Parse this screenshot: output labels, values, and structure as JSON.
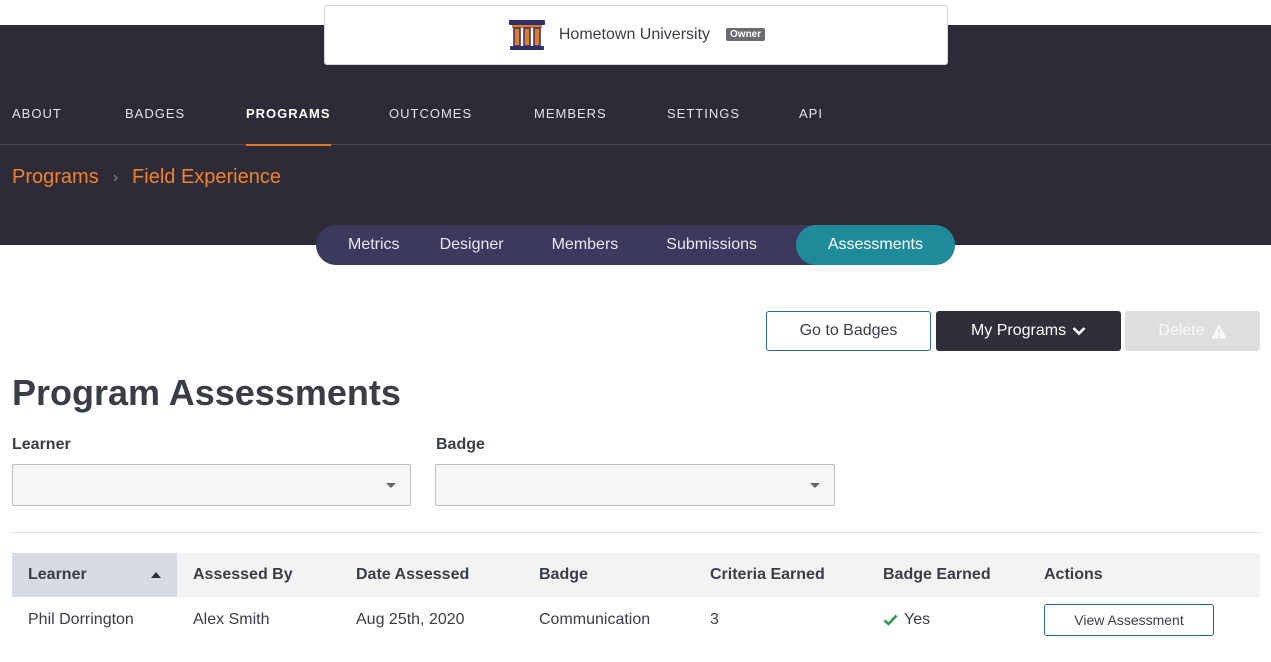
{
  "org": {
    "name": "Hometown University",
    "role_badge": "Owner",
    "logo_icon": "columns-building-icon"
  },
  "nav": {
    "items": [
      "ABOUT",
      "BADGES",
      "PROGRAMS",
      "OUTCOMES",
      "MEMBERS",
      "SETTINGS",
      "API"
    ],
    "active": "PROGRAMS"
  },
  "breadcrumb": {
    "root": "Programs",
    "current": "Field Experience",
    "separator_icon": "chevron-right-icon"
  },
  "subtabs": {
    "items": [
      "Metrics",
      "Designer",
      "Members",
      "Submissions",
      "Assessments"
    ],
    "active": "Assessments"
  },
  "actions": {
    "go_to_badges": "Go to Badges",
    "my_programs": "My Programs",
    "delete": "Delete"
  },
  "page": {
    "title": "Program Assessments"
  },
  "filters": {
    "learner": {
      "label": "Learner",
      "value": ""
    },
    "badge": {
      "label": "Badge",
      "value": ""
    }
  },
  "table": {
    "headers": [
      "Learner",
      "Assessed By",
      "Date Assessed",
      "Badge",
      "Criteria Earned",
      "Badge Earned",
      "Actions"
    ],
    "sorted_column": "Learner",
    "sort_direction": "ascending",
    "rows": [
      {
        "learner": "Phil Dorrington",
        "assessed_by": "Alex Smith",
        "date": "Aug 25th, 2020",
        "badge": "Communication",
        "criteria": "3",
        "badge_earned": "Yes",
        "action": "View Assessment"
      }
    ]
  },
  "colors": {
    "header_bg": "#2e2b38",
    "accent_orange": "#f1822c",
    "active_tab": "#1f8a9a",
    "subtab_bar": "#3c3a5c"
  }
}
